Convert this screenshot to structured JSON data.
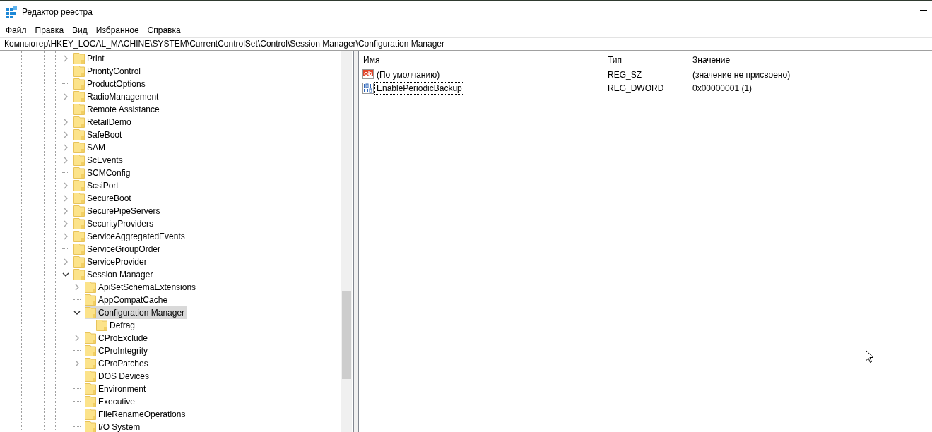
{
  "window": {
    "title": "Редактор реестра"
  },
  "menu": [
    "Файл",
    "Правка",
    "Вид",
    "Избранное",
    "Справка"
  ],
  "address": "Компьютер\\HKEY_LOCAL_MACHINE\\SYSTEM\\CurrentControlSet\\Control\\Session Manager\\Configuration Manager",
  "tree": [
    {
      "label": "Print",
      "has_children": true,
      "expanded": false,
      "selected": false
    },
    {
      "label": "PriorityControl",
      "has_children": false,
      "selected": false
    },
    {
      "label": "ProductOptions",
      "has_children": false,
      "selected": false
    },
    {
      "label": "RadioManagement",
      "has_children": true,
      "expanded": false,
      "selected": false
    },
    {
      "label": "Remote Assistance",
      "has_children": false,
      "selected": false
    },
    {
      "label": "RetailDemo",
      "has_children": true,
      "expanded": false,
      "selected": false
    },
    {
      "label": "SafeBoot",
      "has_children": true,
      "expanded": false,
      "selected": false
    },
    {
      "label": "SAM",
      "has_children": true,
      "expanded": false,
      "selected": false
    },
    {
      "label": "ScEvents",
      "has_children": true,
      "expanded": false,
      "selected": false
    },
    {
      "label": "SCMConfig",
      "has_children": false,
      "selected": false
    },
    {
      "label": "ScsiPort",
      "has_children": true,
      "expanded": false,
      "selected": false
    },
    {
      "label": "SecureBoot",
      "has_children": true,
      "expanded": false,
      "selected": false
    },
    {
      "label": "SecurePipeServers",
      "has_children": true,
      "expanded": false,
      "selected": false
    },
    {
      "label": "SecurityProviders",
      "has_children": true,
      "expanded": false,
      "selected": false
    },
    {
      "label": "ServiceAggregatedEvents",
      "has_children": true,
      "expanded": false,
      "selected": false
    },
    {
      "label": "ServiceGroupOrder",
      "has_children": false,
      "selected": false
    },
    {
      "label": "ServiceProvider",
      "has_children": true,
      "expanded": false,
      "selected": false
    },
    {
      "label": "Session Manager",
      "has_children": true,
      "expanded": true,
      "selected": false,
      "children": [
        {
          "label": "ApiSetSchemaExtensions",
          "has_children": true,
          "expanded": false,
          "selected": false
        },
        {
          "label": "AppCompatCache",
          "has_children": false,
          "selected": false
        },
        {
          "label": "Configuration Manager",
          "has_children": true,
          "expanded": true,
          "selected": true,
          "children": [
            {
              "label": "Defrag",
              "has_children": false,
              "selected": false
            }
          ]
        },
        {
          "label": "CProExclude",
          "has_children": true,
          "expanded": false,
          "selected": false
        },
        {
          "label": "CProIntegrity",
          "has_children": false,
          "selected": false
        },
        {
          "label": "CProPatches",
          "has_children": true,
          "expanded": false,
          "selected": false
        },
        {
          "label": "DOS Devices",
          "has_children": false,
          "selected": false
        },
        {
          "label": "Environment",
          "has_children": false,
          "selected": false
        },
        {
          "label": "Executive",
          "has_children": false,
          "selected": false
        },
        {
          "label": "FileRenameOperations",
          "has_children": false,
          "selected": false
        },
        {
          "label": "I/O System",
          "has_children": false,
          "selected": false
        }
      ]
    }
  ],
  "table": {
    "columns": [
      "Имя",
      "Тип",
      "Значение"
    ],
    "rows": [
      {
        "kind": "string",
        "name": "(По умолчанию)",
        "type": "REG_SZ",
        "value": "(значение не присвоено)",
        "focused": false
      },
      {
        "kind": "dword",
        "name": "EnablePeriodicBackup",
        "type": "REG_DWORD",
        "value": "0x00000001 (1)",
        "focused": true
      }
    ]
  }
}
